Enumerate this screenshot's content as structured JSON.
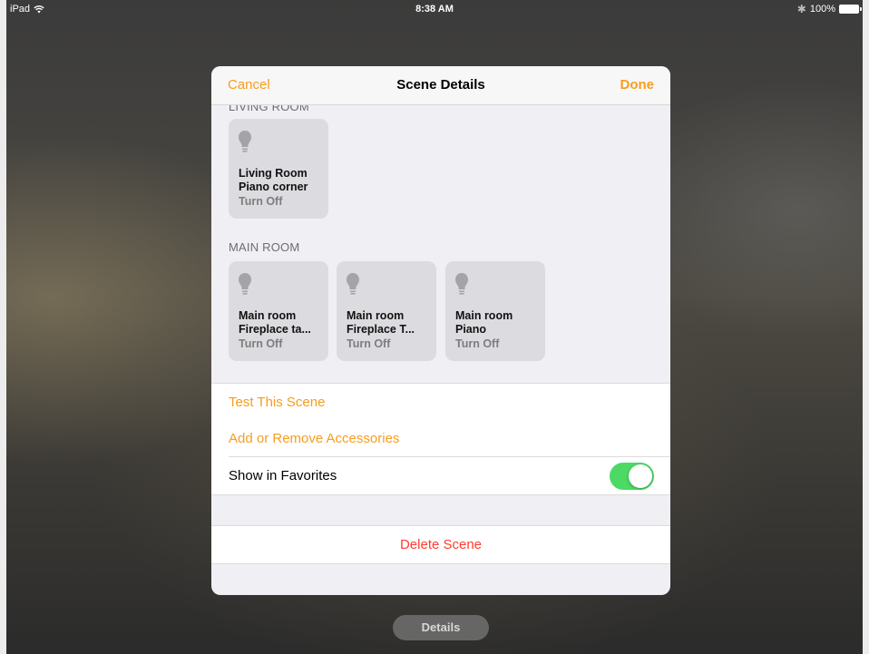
{
  "status_bar": {
    "device": "iPad",
    "time": "8:38 AM",
    "battery_percent": "100%"
  },
  "sheet": {
    "cancel_label": "Cancel",
    "title": "Scene Details",
    "done_label": "Done",
    "sections": [
      {
        "header": "LIVING ROOM",
        "tiles": [
          {
            "name_line1": "Living Room",
            "name_line2": "Piano corner",
            "state": "Turn Off"
          }
        ]
      },
      {
        "header": "MAIN ROOM",
        "tiles": [
          {
            "name_line1": "Main room",
            "name_line2": "Fireplace ta...",
            "state": "Turn Off"
          },
          {
            "name_line1": "Main room",
            "name_line2": "Fireplace T...",
            "state": "Turn Off"
          },
          {
            "name_line1": "Main room",
            "name_line2": "Piano",
            "state": "Turn Off"
          }
        ]
      }
    ],
    "actions": {
      "test_scene": "Test This Scene",
      "add_remove": "Add or Remove Accessories",
      "show_favorites": "Show in Favorites",
      "show_favorites_on": true,
      "delete_scene": "Delete Scene"
    }
  },
  "bottom": {
    "details_label": "Details"
  },
  "icons": {
    "tile_icon": "lightbulb-icon",
    "wifi": "wifi-icon",
    "bluetooth": "bluetooth-icon",
    "battery": "battery-icon"
  },
  "colors": {
    "accent": "#f79d1d",
    "toggle_on": "#4cd964",
    "destructive": "#ff3b30"
  }
}
